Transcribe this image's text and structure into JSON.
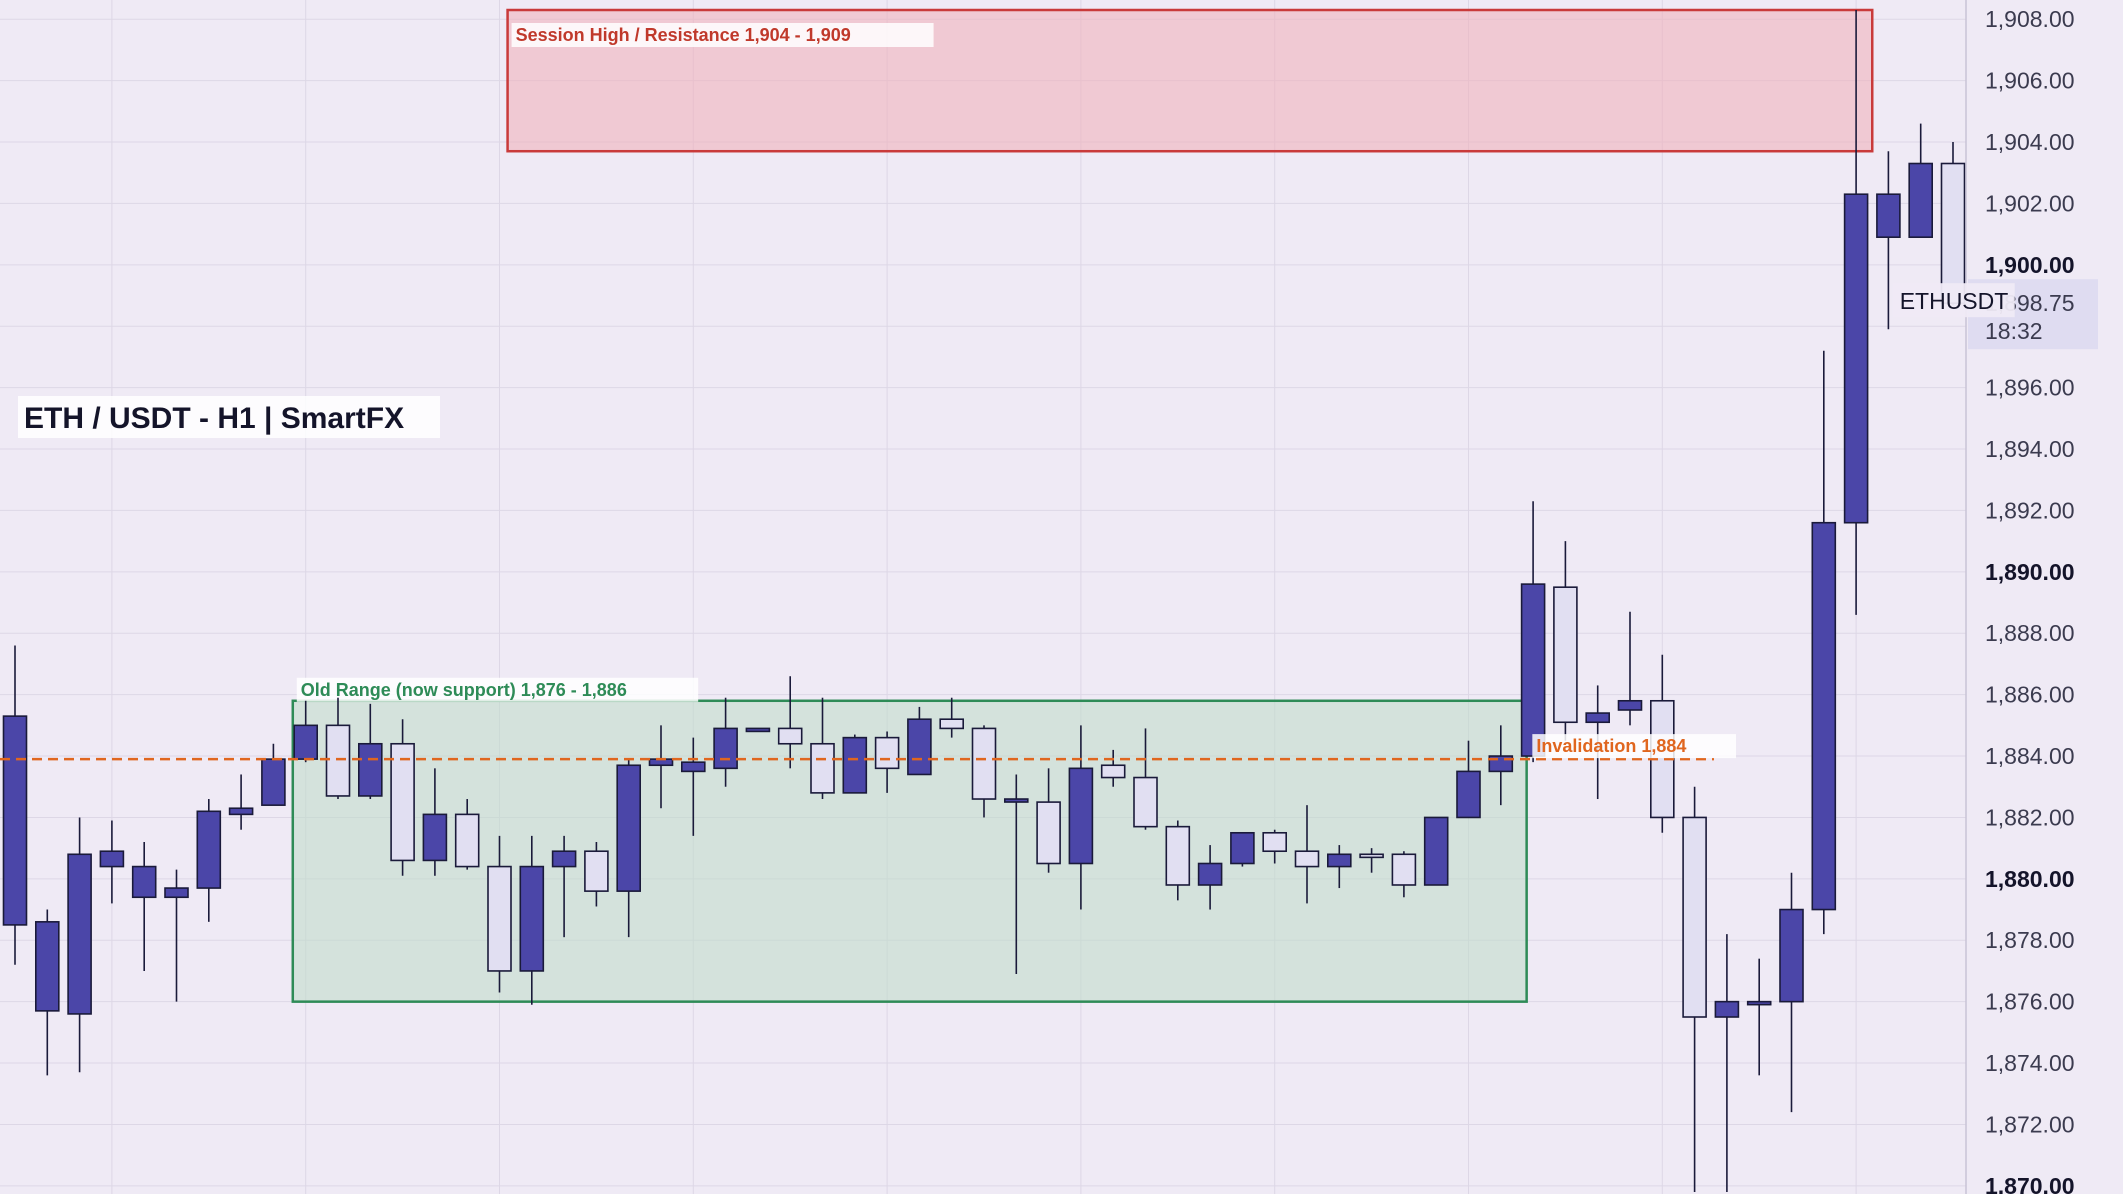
{
  "chart_data": {
    "type": "candlestick",
    "title": "ETH / USDT  -  H1  |  SmartFX",
    "symbol": "ETHUSDT",
    "last_price": "1,898.75",
    "countdown": "18:32",
    "ylim": [
      1869.8,
      1908.3
    ],
    "grid": true,
    "y_ticks": [
      {
        "value": 1870,
        "label": "1,870.00",
        "major": true
      },
      {
        "value": 1872,
        "label": "1,872.00",
        "major": false
      },
      {
        "value": 1874,
        "label": "1,874.00",
        "major": false
      },
      {
        "value": 1876,
        "label": "1,876.00",
        "major": false
      },
      {
        "value": 1878,
        "label": "1,878.00",
        "major": false
      },
      {
        "value": 1880,
        "label": "1,880.00",
        "major": true
      },
      {
        "value": 1882,
        "label": "1,882.00",
        "major": false
      },
      {
        "value": 1884,
        "label": "1,884.00",
        "major": false
      },
      {
        "value": 1886,
        "label": "1,886.00",
        "major": false
      },
      {
        "value": 1888,
        "label": "1,888.00",
        "major": false
      },
      {
        "value": 1890,
        "label": "1,890.00",
        "major": true
      },
      {
        "value": 1892,
        "label": "1,892.00",
        "major": false
      },
      {
        "value": 1894,
        "label": "1,894.00",
        "major": false
      },
      {
        "value": 1896,
        "label": "1,896.00",
        "major": false
      },
      {
        "value": 1898,
        "label": "1,898.00",
        "major": false
      },
      {
        "value": 1900,
        "label": "1,900.00",
        "major": true
      },
      {
        "value": 1902,
        "label": "1,902.00",
        "major": false
      },
      {
        "value": 1904,
        "label": "1,904.00",
        "major": false
      },
      {
        "value": 1906,
        "label": "1,906.00",
        "major": false
      },
      {
        "value": 1908,
        "label": "1,908.00",
        "major": false
      }
    ],
    "zones": [
      {
        "label": "Session High / Resistance  1,904 - 1,909",
        "y_low": 1903.7,
        "y_high": 1908.3,
        "start_index": 15.25,
        "end_index": 57.5,
        "fill": "#f0b2bd",
        "stroke": "#c93a3a",
        "text_color": "#c0392b"
      },
      {
        "label": "Old Range (now support)  1,876 - 1,886",
        "y_low": 1876.0,
        "y_high": 1885.8,
        "start_index": 8.6,
        "end_index": 46.8,
        "fill": "#c2dccc",
        "stroke": "#2e8b57",
        "text_color": "#2e8b57"
      }
    ],
    "invalidation": {
      "label": "Invalidation  1,884",
      "value": 1883.9,
      "color": "#e0661f"
    },
    "colors": {
      "bull": "#4b46a8",
      "bear": "#e1dff2",
      "outline": "#1a1a3a",
      "background": "#efeaf5"
    },
    "candles": [
      {
        "o": 1878.5,
        "h": 1887.6,
        "l": 1877.2,
        "c": 1885.3
      },
      {
        "o": 1875.7,
        "h": 1879.0,
        "l": 1873.6,
        "c": 1878.6
      },
      {
        "o": 1875.6,
        "h": 1882.0,
        "l": 1873.7,
        "c": 1880.8
      },
      {
        "o": 1880.4,
        "h": 1881.9,
        "l": 1879.2,
        "c": 1880.9
      },
      {
        "o": 1879.4,
        "h": 1881.2,
        "l": 1877.0,
        "c": 1880.4
      },
      {
        "o": 1879.4,
        "h": 1880.3,
        "l": 1876.0,
        "c": 1879.7
      },
      {
        "o": 1879.7,
        "h": 1882.6,
        "l": 1878.6,
        "c": 1882.2
      },
      {
        "o": 1882.1,
        "h": 1883.4,
        "l": 1881.6,
        "c": 1882.3
      },
      {
        "o": 1882.4,
        "h": 1884.4,
        "l": 1882.4,
        "c": 1883.9
      },
      {
        "o": 1883.9,
        "h": 1885.8,
        "l": 1883.8,
        "c": 1885.0
      },
      {
        "o": 1885.0,
        "h": 1885.9,
        "l": 1882.6,
        "c": 1882.7
      },
      {
        "o": 1882.7,
        "h": 1885.7,
        "l": 1882.6,
        "c": 1884.4
      },
      {
        "o": 1884.4,
        "h": 1885.2,
        "l": 1880.1,
        "c": 1880.6
      },
      {
        "o": 1880.6,
        "h": 1883.6,
        "l": 1880.1,
        "c": 1882.1
      },
      {
        "o": 1882.1,
        "h": 1882.6,
        "l": 1880.3,
        "c": 1880.4
      },
      {
        "o": 1880.4,
        "h": 1881.4,
        "l": 1876.3,
        "c": 1877.0
      },
      {
        "o": 1877.0,
        "h": 1881.4,
        "l": 1875.9,
        "c": 1880.4
      },
      {
        "o": 1880.4,
        "h": 1881.4,
        "l": 1878.1,
        "c": 1880.9
      },
      {
        "o": 1880.9,
        "h": 1881.2,
        "l": 1879.1,
        "c": 1879.6
      },
      {
        "o": 1879.6,
        "h": 1883.9,
        "l": 1878.1,
        "c": 1883.7
      },
      {
        "o": 1883.7,
        "h": 1885.0,
        "l": 1882.3,
        "c": 1883.9
      },
      {
        "o": 1883.5,
        "h": 1884.6,
        "l": 1881.4,
        "c": 1883.8
      },
      {
        "o": 1883.6,
        "h": 1885.9,
        "l": 1883.0,
        "c": 1884.9
      },
      {
        "o": 1884.9,
        "h": 1884.9,
        "l": 1884.9,
        "c": 1884.9
      },
      {
        "o": 1884.9,
        "h": 1886.6,
        "l": 1883.6,
        "c": 1884.4
      },
      {
        "o": 1884.4,
        "h": 1885.9,
        "l": 1882.6,
        "c": 1882.8
      },
      {
        "o": 1882.8,
        "h": 1884.7,
        "l": 1882.9,
        "c": 1884.6
      },
      {
        "o": 1884.6,
        "h": 1884.8,
        "l": 1882.8,
        "c": 1883.6
      },
      {
        "o": 1883.4,
        "h": 1885.6,
        "l": 1883.4,
        "c": 1885.2
      },
      {
        "o": 1885.2,
        "h": 1885.9,
        "l": 1884.6,
        "c": 1884.9
      },
      {
        "o": 1884.9,
        "h": 1885.0,
        "l": 1882.0,
        "c": 1882.6
      },
      {
        "o": 1882.6,
        "h": 1883.4,
        "l": 1876.9,
        "c": 1882.6
      },
      {
        "o": 1882.5,
        "h": 1883.6,
        "l": 1880.2,
        "c": 1880.5
      },
      {
        "o": 1880.5,
        "h": 1885.0,
        "l": 1879.0,
        "c": 1883.6
      },
      {
        "o": 1883.7,
        "h": 1884.2,
        "l": 1883.0,
        "c": 1883.3
      },
      {
        "o": 1883.3,
        "h": 1884.9,
        "l": 1881.6,
        "c": 1881.7
      },
      {
        "o": 1881.7,
        "h": 1881.9,
        "l": 1879.3,
        "c": 1879.8
      },
      {
        "o": 1879.8,
        "h": 1881.1,
        "l": 1879.0,
        "c": 1880.5
      },
      {
        "o": 1880.5,
        "h": 1881.5,
        "l": 1880.4,
        "c": 1881.5
      },
      {
        "o": 1881.5,
        "h": 1881.6,
        "l": 1880.5,
        "c": 1880.9
      },
      {
        "o": 1880.9,
        "h": 1882.4,
        "l": 1879.2,
        "c": 1880.4
      },
      {
        "o": 1880.4,
        "h": 1881.1,
        "l": 1879.7,
        "c": 1880.8
      },
      {
        "o": 1880.8,
        "h": 1881.0,
        "l": 1880.2,
        "c": 1880.7
      },
      {
        "o": 1880.8,
        "h": 1880.9,
        "l": 1879.4,
        "c": 1879.8
      },
      {
        "o": 1879.8,
        "h": 1882.0,
        "l": 1879.8,
        "c": 1882.0
      },
      {
        "o": 1882.0,
        "h": 1884.5,
        "l": 1882.0,
        "c": 1883.5
      },
      {
        "o": 1883.5,
        "h": 1885.0,
        "l": 1882.4,
        "c": 1884.0
      },
      {
        "o": 1884.0,
        "h": 1892.3,
        "l": 1883.8,
        "c": 1889.6
      },
      {
        "o": 1889.5,
        "h": 1891.0,
        "l": 1884.5,
        "c": 1885.1
      },
      {
        "o": 1885.1,
        "h": 1886.3,
        "l": 1882.6,
        "c": 1885.4
      },
      {
        "o": 1885.5,
        "h": 1888.7,
        "l": 1885.0,
        "c": 1885.8
      },
      {
        "o": 1885.8,
        "h": 1887.3,
        "l": 1881.5,
        "c": 1882.0
      },
      {
        "o": 1882.0,
        "h": 1883.0,
        "l": 1869.8,
        "c": 1875.5
      },
      {
        "o": 1875.5,
        "h": 1878.2,
        "l": 1869.8,
        "c": 1876.0
      },
      {
        "o": 1876.0,
        "h": 1877.4,
        "l": 1873.6,
        "c": 1876.0
      },
      {
        "o": 1876.0,
        "h": 1880.2,
        "l": 1872.4,
        "c": 1879.0
      },
      {
        "o": 1879.0,
        "h": 1897.2,
        "l": 1878.2,
        "c": 1891.6
      },
      {
        "o": 1891.6,
        "h": 1908.3,
        "l": 1888.6,
        "c": 1902.3
      },
      {
        "o": 1900.9,
        "h": 1903.7,
        "l": 1897.9,
        "c": 1902.3
      },
      {
        "o": 1900.9,
        "h": 1904.6,
        "l": 1900.9,
        "c": 1903.3
      },
      {
        "o": 1903.3,
        "h": 1904.0,
        "l": 1898.7,
        "c": 1898.75
      }
    ]
  }
}
